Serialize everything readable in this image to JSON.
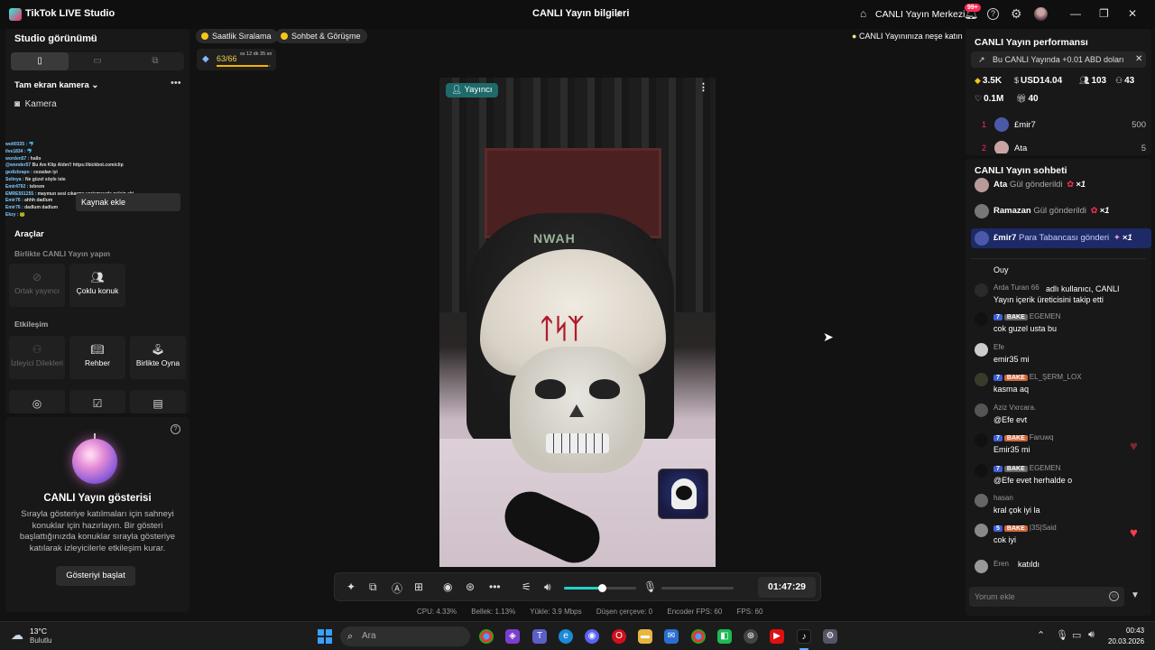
{
  "titlebar": {
    "app_name": "TikTok LIVE Studio",
    "center_title": "CANLI Yayın bilgileri",
    "live_center": "CANLI Yayın Merkezi",
    "notif_badge": "99+"
  },
  "left": {
    "studio_view": "Studio görünümü",
    "camera_section": "Tam ekran kamera",
    "camera_source": "Kamera",
    "add_source_tooltip": "Kaynak ekle",
    "tools_label": "Araçlar",
    "together_label": "Birlikte CANLI Yayın yapın",
    "cohost": "Ortak yayıncı",
    "multi_guest": "Çoklu konuk",
    "interaction_label": "Etkileşim",
    "viewer_requests": "İzleyici Dilekleri",
    "guide": "Rehber",
    "play_together": "Birlikte Oyna",
    "overlay_chat": [
      {
        "n": "wolt0335 :",
        "t": "🐬"
      },
      {
        "n": "ilve1834 :",
        "t": "🐬"
      },
      {
        "n": "worden57 :",
        "t": "hallo"
      },
      {
        "n": "@wonder57",
        "t": "Bu Anı Klip Aldın!! https://kickbot.com/clip"
      },
      {
        "n": "gedizbrapo :",
        "t": "cezadan iyi"
      },
      {
        "n": "Selinya :",
        "t": "Ne güzel söyle iste"
      },
      {
        "n": "Emir4792 :",
        "t": "tebrem"
      },
      {
        "n": "EMRE551255 :",
        "t": "maymun sesi cıkarma yarişmasıda gelsin abi"
      },
      {
        "n": "Emir76 :",
        "t": "ahhh dadlum"
      },
      {
        "n": "Emir76 :",
        "t": "dadlum dadlum"
      },
      {
        "n": "Ekzy :",
        "t": "🐸"
      }
    ]
  },
  "show": {
    "title": "CANLI Yayın gösterisi",
    "description": "Sırayla gösteriye katılmaları için sahneyi konuklar için hazırlayın. Bir gösteri başlattığınızda konuklar sırayla gösteriye katılarak izleyicilerle etkileşim kurar.",
    "button": "Gösteriyi başlat"
  },
  "pills": {
    "hourly": "Saatlik Sıralama",
    "chat_meet": "Sohbet & Görüşme",
    "hint": "CANLI Yayınınıza neşe katın"
  },
  "level": {
    "value": "63/66",
    "time_left": "ss 12 dk 35 sn",
    "progress": 0.95
  },
  "video": {
    "host_badge": "Yayıncı",
    "chair_logo": "NWAH"
  },
  "controls": {
    "timer": "01:47:29",
    "volume": 0.52
  },
  "stats": {
    "cpu": "CPU:  4.33%",
    "memory": "Bellek:  1.13%",
    "upload": "Yükle:  3.9 Mbps",
    "dropped": "Düşen çerçeve:  0",
    "encoder_fps": "Encoder FPS:  60",
    "fps": "FPS:  60"
  },
  "performance": {
    "title": "CANLI Yayın performansı",
    "note": "Bu CANLI Yayında +0.01 ABD doları",
    "diamonds": "3.5K",
    "usd": "USD14.04",
    "viewers": "103",
    "new_followers": "43",
    "likes": "0.1M",
    "gifters": "40",
    "ranking": [
      {
        "rank": "1",
        "name": "£mir7",
        "score": "500"
      },
      {
        "rank": "2",
        "name": "Ata",
        "score": "5"
      }
    ]
  },
  "chat": {
    "title": "CANLI Yayın sohbeti",
    "gifts": [
      {
        "name": "Ata",
        "verb": "Gül gönderildi",
        "count": "×1"
      },
      {
        "name": "Ramazan",
        "verb": "Gül gönderildi",
        "count": "×1"
      },
      {
        "name": "£mir7",
        "verb": "Para Tabancası gönderi",
        "count": "×1"
      }
    ],
    "messages": [
      {
        "head": "",
        "body": "Ouy"
      },
      {
        "head": "Arda Turan 66",
        "body": "adlı kullanıcı, CANLI Yayın içerik üreticisini takip etti"
      },
      {
        "lv": "7",
        "badge": "BAKE",
        "head": "EGEMEN",
        "body": "cok guzel usta bu"
      },
      {
        "head": "Efe",
        "body": "emir35 mi"
      },
      {
        "lv": "7",
        "badge": "BAKE",
        "head": "EL_ŞERM_LOX",
        "body": "kasma aq"
      },
      {
        "head": "Aziz Vxrcara.",
        "body": "@Efe evt"
      },
      {
        "lv": "7",
        "badge": "BAKE",
        "head": "Faruwq",
        "body": "Emir35 mi"
      },
      {
        "lv": "7",
        "badge": "BAKE",
        "head": "EGEMEN",
        "body": "@Efe evet herhalde o"
      },
      {
        "head": "hasan",
        "body": "kral çok iyi la"
      },
      {
        "lv": "5",
        "badge": "BAKE",
        "head": "|3S|Said",
        "body": "cok iyi"
      },
      {
        "head": "Eren",
        "body": "katıldı"
      }
    ],
    "input_placeholder": "Yorum ekle"
  },
  "taskbar": {
    "temp": "13°C",
    "weather": "Bulutlu",
    "search": "Ara",
    "time": "00:43",
    "date": "20.03.2026"
  }
}
